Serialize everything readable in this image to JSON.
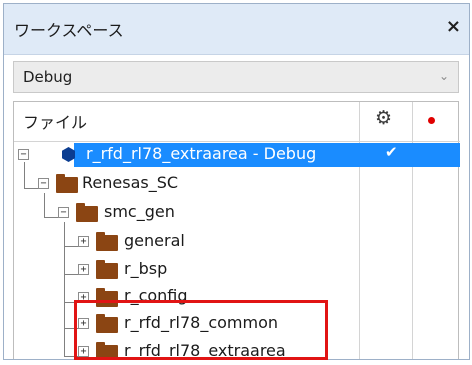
{
  "window": {
    "title": "ワークスペース",
    "close_label": "×"
  },
  "config_select": {
    "value": "Debug"
  },
  "tree": {
    "header_label": "ファイル",
    "columns": [
      {
        "icon": "gear-icon",
        "glyph": "⚙"
      },
      {
        "icon": "red-dot-icon"
      }
    ],
    "project": {
      "name": "r_rfd_rl78_extraarea - Debug",
      "check": "✔",
      "selected": true
    },
    "nodes": [
      {
        "name": "Renesas_SC",
        "expander": "−"
      },
      {
        "name": "smc_gen",
        "expander": "−"
      },
      {
        "name": "general",
        "expander": "+"
      },
      {
        "name": "r_bsp",
        "expander": "+"
      },
      {
        "name": "r_config",
        "expander": "+"
      },
      {
        "name": "r_rfd_rl78_common",
        "expander": "+"
      },
      {
        "name": "r_rfd_rl78_extraarea",
        "expander": "+"
      }
    ],
    "root_expander": "−"
  },
  "colors": {
    "selection": "#1a8cff",
    "folder": "#8b4513",
    "highlight_border": "#e11414",
    "project_icon": "#0b3d91"
  }
}
